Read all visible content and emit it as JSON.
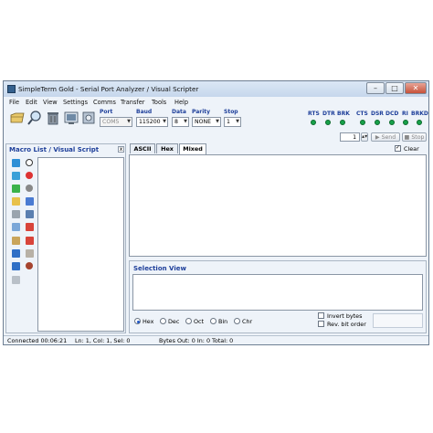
{
  "window": {
    "title": "SimpleTerm Gold - Serial Port Analyzer / Visual Scripter",
    "controls": {
      "minimize": "–",
      "maximize": "□",
      "close": "✕"
    }
  },
  "menu": [
    "File",
    "Edit",
    "View",
    "Settings",
    "Comms",
    "Transfer",
    "Tools",
    "Help"
  ],
  "toolbar_icons": [
    "open-folder-icon",
    "magnifier-icon",
    "trash-icon",
    "terminal-icon",
    "settings-icon"
  ],
  "port_settings": {
    "port_label": "Port",
    "port_value": "COM5",
    "baud_label": "Baud",
    "baud_value": "115200",
    "data_label": "Data",
    "data_value": "8",
    "parity_label": "Parity",
    "parity_value": "NONE",
    "stop_label": "Stop",
    "stop_value": "1"
  },
  "signals_out": [
    "RTS",
    "DTR",
    "BRK"
  ],
  "signals_in": [
    "CTS",
    "DSR",
    "DCD",
    "RI",
    "BRKD"
  ],
  "send_bar": {
    "count": "1",
    "send_label": "Send",
    "stop_label": "Stop"
  },
  "macro_panel": {
    "title": "Macro List / Visual Script"
  },
  "terminal": {
    "tabs": [
      "ASCII",
      "Hex",
      "Mixed"
    ],
    "active_tab": "Mixed",
    "clear_label": "Clear"
  },
  "selection_view": {
    "title": "Selection View",
    "formats": [
      "Hex",
      "Dec",
      "Oct",
      "Bin",
      "Chr"
    ],
    "selected_format": "Hex",
    "invert_label": "Invert bytes",
    "rev_label": "Rev. bit order"
  },
  "status": {
    "connected": "Connected 00:06:21",
    "position": "Ln: 1, Col: 1, Sel: 0",
    "bytes": "Bytes Out: 0  In: 0  Total: 0"
  },
  "colors": {
    "accent": "#1e3f9a",
    "led": "#18a14a",
    "frame": "#eef3f9"
  }
}
